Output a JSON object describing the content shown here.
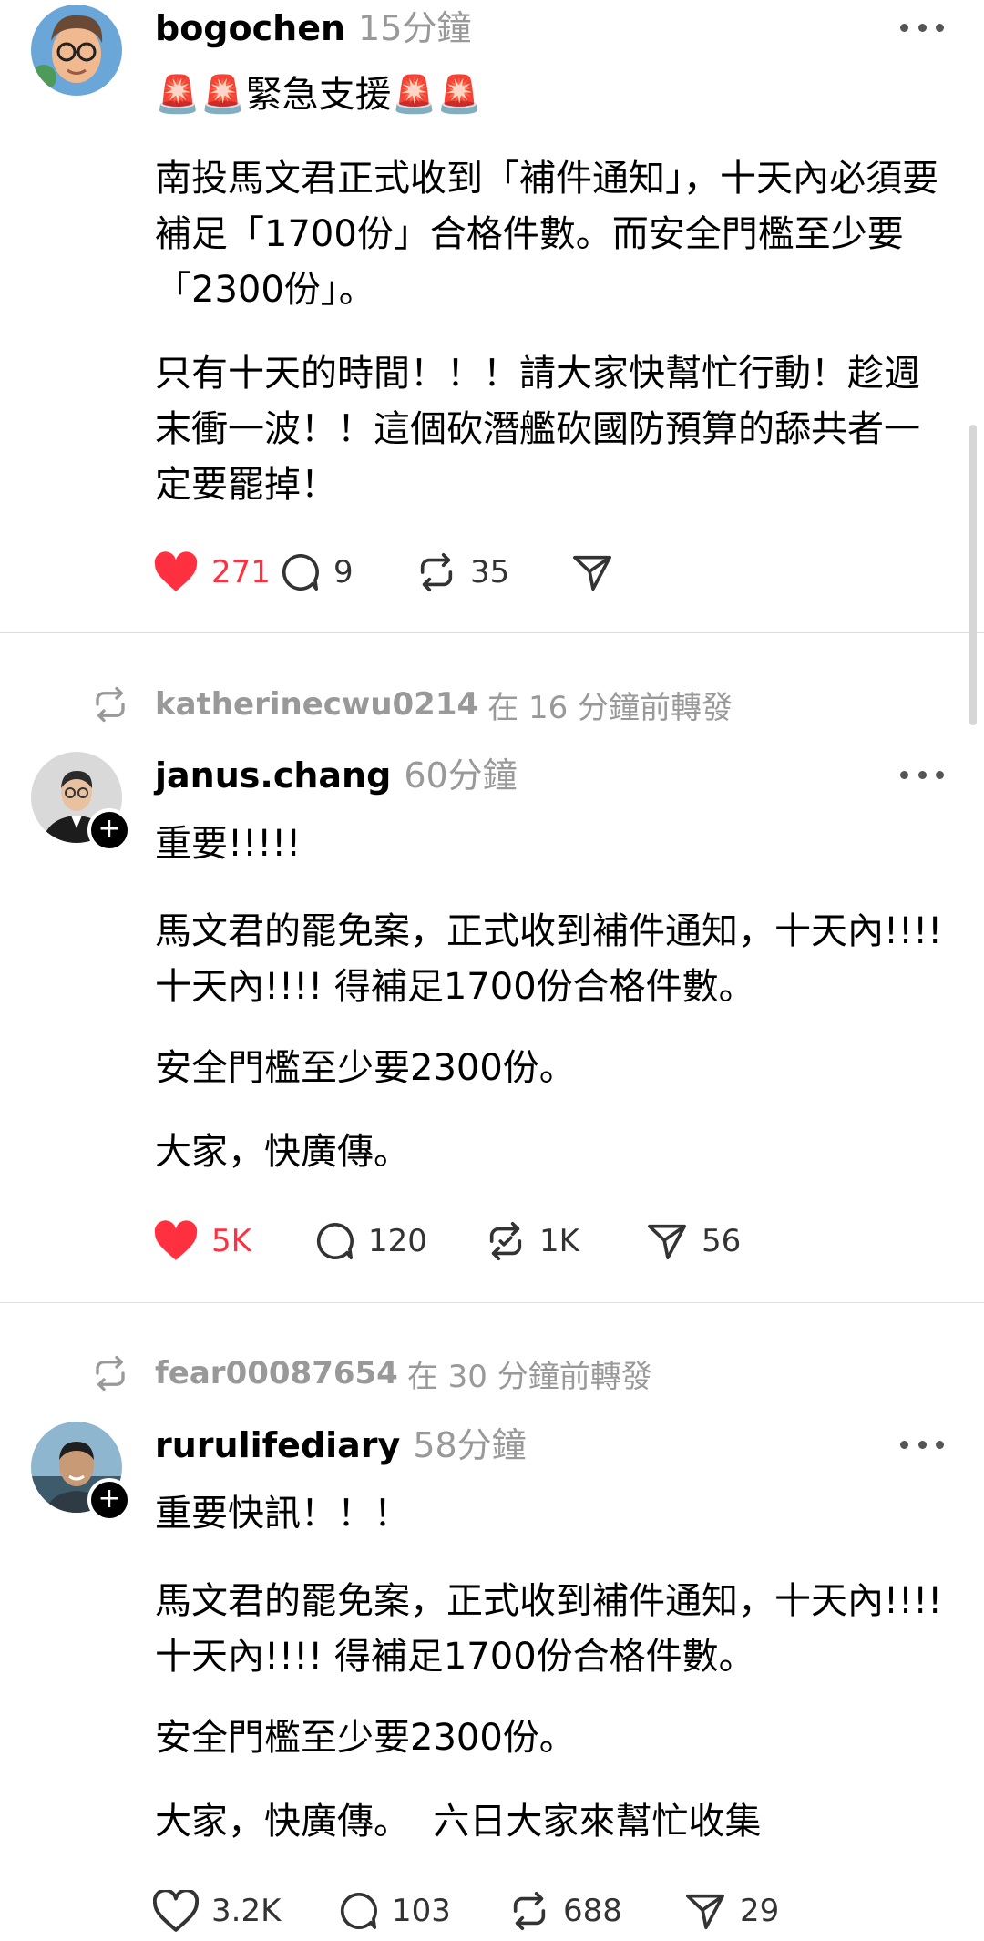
{
  "posts": [
    {
      "username": "bogochen",
      "time": "15分鐘",
      "emoji_line": "🚨🚨緊急支援🚨🚨",
      "paragraphs": [
        "南投馬文君正式收到「補件通知」，十天內必須要補足「1700份」合格件數。而安全門檻至少要「2300份」。",
        "只有十天的時間！！！請大家快幫忙行動！趁週末衝一波！！這個砍潛艦砍國防預算的舔共者一定要罷掉！"
      ],
      "likes": "271",
      "comments": "9",
      "reposts": "35",
      "shares": "",
      "liked": true
    },
    {
      "repost_by": "katherinecwu0214",
      "repost_suffix": "在 16 分鐘前轉發",
      "username": "janus.chang",
      "time": "60分鐘",
      "paragraphs": [
        "重要!!!!!",
        "馬文君的罷免案，正式收到補件通知，十天內!!!! 十天內!!!! 得補足1700份合格件數。",
        "安全門檻至少要2300份。",
        "大家，快廣傳。"
      ],
      "likes": "5K",
      "comments": "120",
      "reposts": "1K",
      "shares": "56",
      "liked": true
    },
    {
      "repost_by": "fear00087654",
      "repost_suffix": "在 30 分鐘前轉發",
      "username": "rurulifediary",
      "time": "58分鐘",
      "paragraphs": [
        "重要快訊！！！",
        "馬文君的罷免案，正式收到補件通知，十天內!!!! 十天內!!!! 得補足1700份合格件數。",
        "安全門檻至少要2300份。",
        "大家，快廣傳。  六日大家來幫忙收集"
      ],
      "likes": "3.2K",
      "comments": "103",
      "reposts": "688",
      "shares": "29",
      "liked": false
    }
  ],
  "colors": {
    "like_red": "#ff3040",
    "muted": "#999999",
    "divider": "#dedede"
  },
  "icons": [
    "more-icon",
    "heart-icon",
    "comment-icon",
    "repost-icon",
    "share-icon",
    "follow-plus-icon"
  ]
}
